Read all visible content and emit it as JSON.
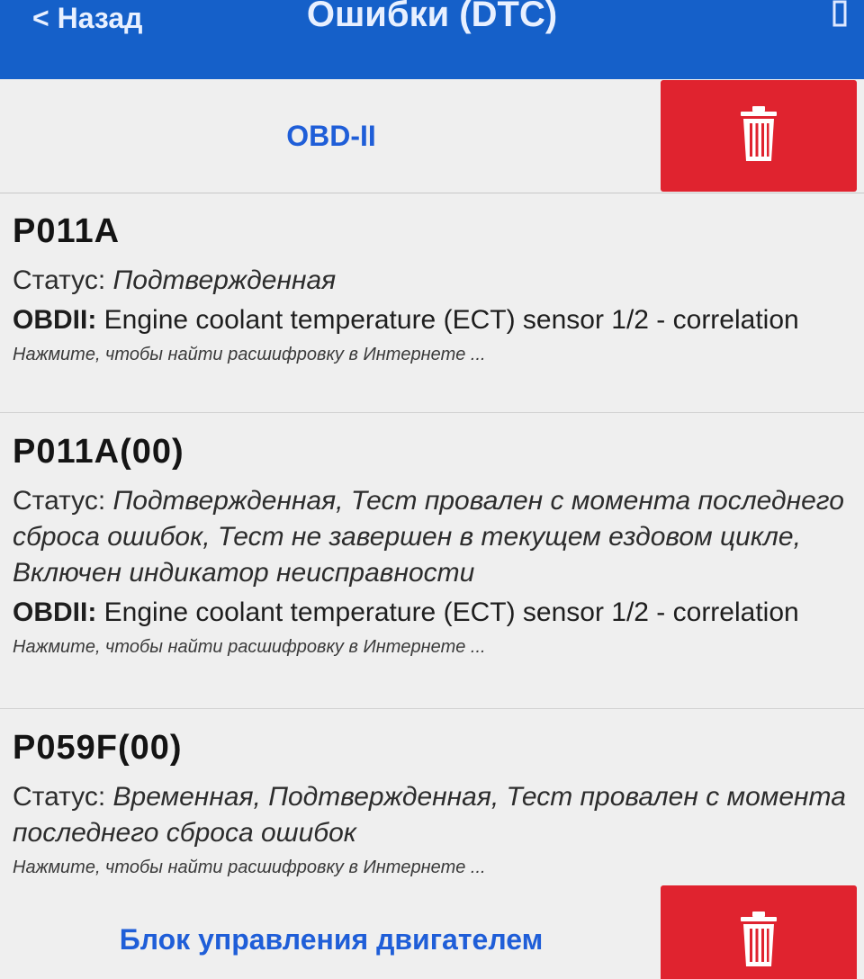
{
  "navbar": {
    "back_label": "< Назад",
    "title": "Ошибки (DTC)",
    "background": "#1560c9"
  },
  "sections": [
    {
      "title": "OBD-II",
      "delete_icon": "trash-icon"
    },
    {
      "title": "Блок управления двигателем",
      "delete_icon": "trash-icon"
    }
  ],
  "dtc_items": [
    {
      "code": "P011A",
      "status_label": "Статус:",
      "status_value": "Подтвержденная",
      "desc_prefix": "OBDII:",
      "desc_text": "Engine coolant temperature (ECT) sensor 1/2 - correlation",
      "hint": "Нажмите, чтобы найти расшифровку в Интернете ..."
    },
    {
      "code": "P011A(00)",
      "status_label": "Статус:",
      "status_value": "Подтвержденная, Тест провален с момента последнего сброса ошибок, Тест не завершен в текущем ездовом цикле, Включен индикатор неисправности",
      "desc_prefix": "OBDII:",
      "desc_text": "Engine coolant temperature (ECT) sensor 1/2 - correlation",
      "hint": "Нажмите, чтобы найти расшифровку в Интернете ..."
    },
    {
      "code": "P059F(00)",
      "status_label": "Статус:",
      "status_value": "Временная, Подтвержденная, Тест провален с момента последнего сброса ошибок",
      "hint": "Нажмите, чтобы найти расшифровку в Интернете ..."
    }
  ],
  "colors": {
    "accent_blue": "#1f5ed8",
    "delete_red": "#e0232f",
    "list_background": "#efefef"
  }
}
